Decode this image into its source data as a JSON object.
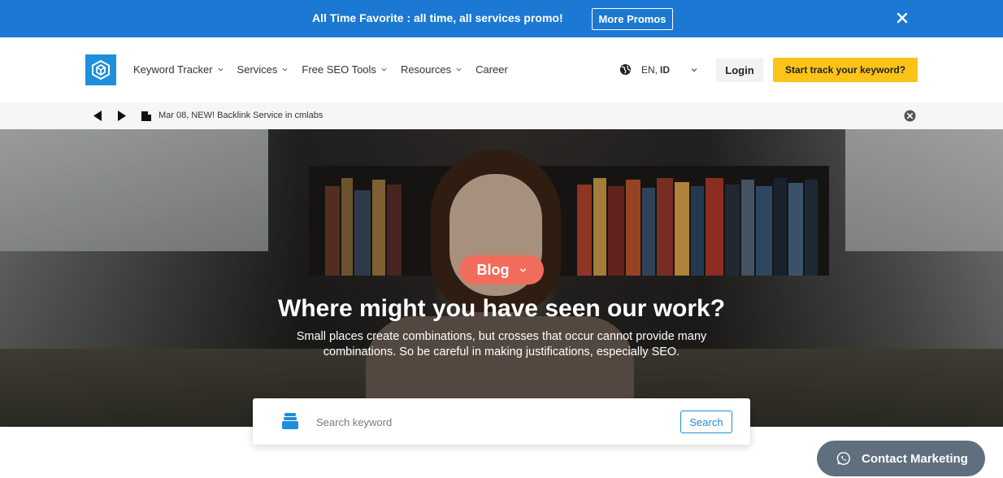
{
  "promo": {
    "text": "All Time Favorite : all time, all services promo!",
    "button_label": "More Promos",
    "close_icon": "close-icon",
    "color": "#1b78d3"
  },
  "header": {
    "logo_icon": "cmlabs-logo-icon",
    "nav": [
      {
        "label": "Keyword Tracker",
        "has_dropdown": true
      },
      {
        "label": "Services",
        "has_dropdown": true
      },
      {
        "label": "Free SEO Tools",
        "has_dropdown": true
      },
      {
        "label": "Resources",
        "has_dropdown": true
      },
      {
        "label": "Career",
        "has_dropdown": false
      }
    ],
    "language": {
      "current": "EN,",
      "other": "ID",
      "icon": "globe-icon"
    },
    "login_label": "Login",
    "cta_label": "Start track your keyword?",
    "cta_color": "#fcc419"
  },
  "ticker": {
    "text": "Mar 08, NEW! Backlink Service in cmlabs",
    "icons": [
      "prev-arrow-icon",
      "next-arrow-icon",
      "news-tag-icon",
      "close-circle-icon"
    ]
  },
  "hero": {
    "category_label": "Blog",
    "title": "Where might you have seen our work?",
    "subtitle": "Small places create combinations, but crosses that occur cannot provide many combinations. So be careful in making justifications, especially SEO.",
    "pill_color": "#f26c5c"
  },
  "search": {
    "placeholder": "Search keyword",
    "button_label": "Search",
    "icon": "stack-icon"
  },
  "contact": {
    "label": "Contact Marketing",
    "icon": "whatsapp-icon"
  }
}
